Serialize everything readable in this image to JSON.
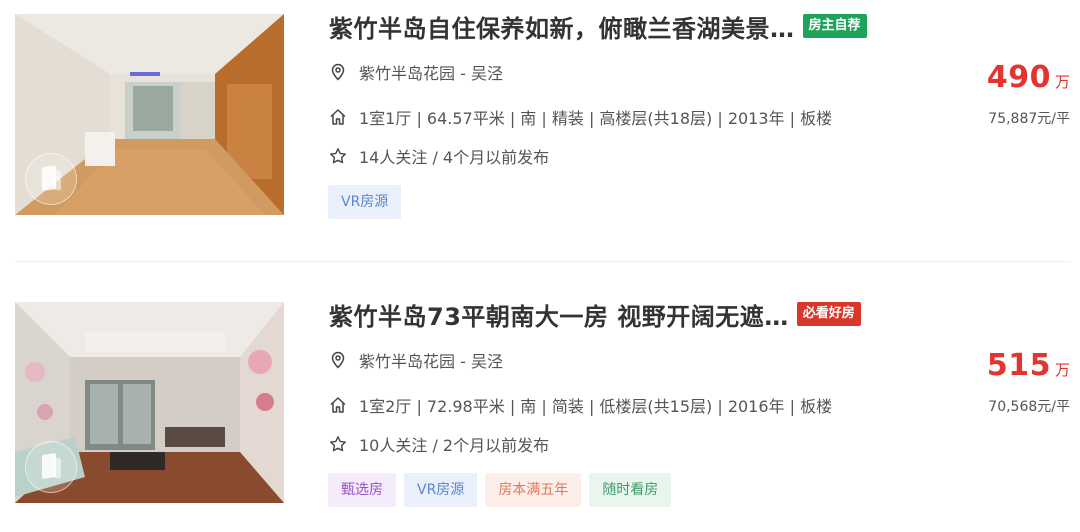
{
  "listings": [
    {
      "title": "紫竹半岛自住保养如新，俯瞰兰香湖美景…",
      "badge": "房主自荐",
      "badge_color": "#1fa259",
      "location": "紫竹半岛花园 - 吴泾",
      "house_info": "1室1厅 | 64.57平米 | 南 | 精装 | 高楼层(共18层) | 2013年 | 板楼",
      "follow_info": "14人关注 / 4个月以前发布",
      "tags": [
        "VR房源"
      ],
      "total_price": "490",
      "price_unit": "万",
      "unit_price": "75,887元/平"
    },
    {
      "title": "紫竹半岛73平朝南大一房 视野开阔无遮…",
      "badge": "必看好房",
      "badge_color": "#d9362c",
      "location": "紫竹半岛花园 - 吴泾",
      "house_info": "1室2厅 | 72.98平米 | 南 | 简装 | 低楼层(共15层) | 2016年 | 板楼",
      "follow_info": "10人关注 / 2个月以前发布",
      "tags": [
        "甄选房",
        "VR房源",
        "房本满五年",
        "随时看房"
      ],
      "total_price": "515",
      "price_unit": "万",
      "unit_price": "70,568元/平"
    }
  ],
  "icons": {
    "location": "map-pin-icon",
    "house": "house-icon",
    "follow": "star-icon",
    "vr": "vr-cube-icon"
  },
  "colors": {
    "price": "#e3342f",
    "title": "#333333"
  }
}
